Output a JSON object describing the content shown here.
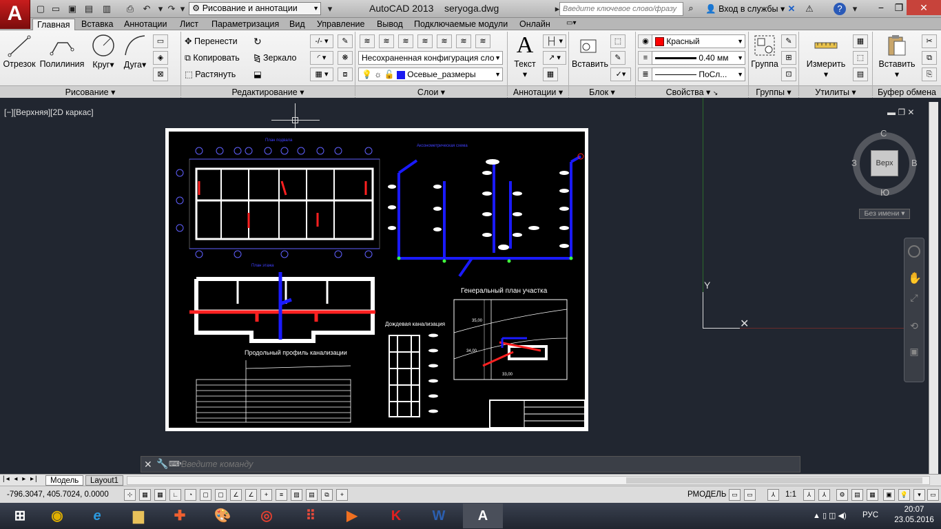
{
  "titlebar": {
    "logo": "A",
    "workspace": "Рисование и аннотации",
    "app_title": "AutoCAD 2013    seryoga.dwg",
    "search_placeholder": "Введите ключевое слово/фразу",
    "signin": "Вход в службы"
  },
  "tabs": [
    "Главная",
    "Вставка",
    "Аннотации",
    "Лист",
    "Параметризация",
    "Вид",
    "Управление",
    "Вывод",
    "Подключаемые модули",
    "Онлайн"
  ],
  "ribbon": {
    "draw": {
      "title": "Рисование",
      "line": "Отрезок",
      "polyline": "Полилиния",
      "circle": "Круг",
      "arc": "Дуга"
    },
    "modify": {
      "title": "Редактирование",
      "move": "Перенести",
      "copy": "Копировать",
      "stretch": "Растянуть",
      "mirror": "Зеркало"
    },
    "layers": {
      "title": "Слои",
      "config": "Несохраненная конфигурация сло",
      "layer": "Осевые_размеры"
    },
    "annotation": {
      "title": "Аннотации",
      "text": "Текст"
    },
    "block": {
      "title": "Блок",
      "insert": "Вставить"
    },
    "properties": {
      "title": "Свойства",
      "color": "Красный",
      "lineweight": "0.40 мм",
      "linetype": "ПоСл...",
      "color_hex": "#ff0000"
    },
    "groups": {
      "title": "Группы",
      "group": "Группа"
    },
    "utilities": {
      "title": "Утилиты",
      "measure": "Измерить"
    },
    "clipboard": {
      "title": "Буфер обмена",
      "paste": "Вставить"
    }
  },
  "viewport": {
    "label": "[−][Верхняя][2D каркас]",
    "cube_face": "Верх",
    "north": "С",
    "south": "Ю",
    "west": "З",
    "east": "В",
    "named_view": "Без имени",
    "ucs_y": "Y"
  },
  "drawing": {
    "title_plan_1": "Генеральный план участка",
    "title_profile": "Продольный профиль канализации",
    "title_rain": "Дождевая канализация",
    "title_top_plan": "План подвала",
    "title_axon": "Аксонометрическая схема",
    "title_sec_plan": "План этажа",
    "elev_1": "35,00",
    "elev_2": "34,00",
    "elev_3": "33,00"
  },
  "command": {
    "placeholder": "Введите команду"
  },
  "layout_tabs": [
    "Модель",
    "Layout1"
  ],
  "status": {
    "coords": "-796.3047, 405.7024, 0.0000",
    "rmodel": "РМОДЕЛЬ",
    "scale": "1:1"
  },
  "taskbar": {
    "lang": "РУС",
    "time": "20:07",
    "date": "23.05.2016"
  }
}
